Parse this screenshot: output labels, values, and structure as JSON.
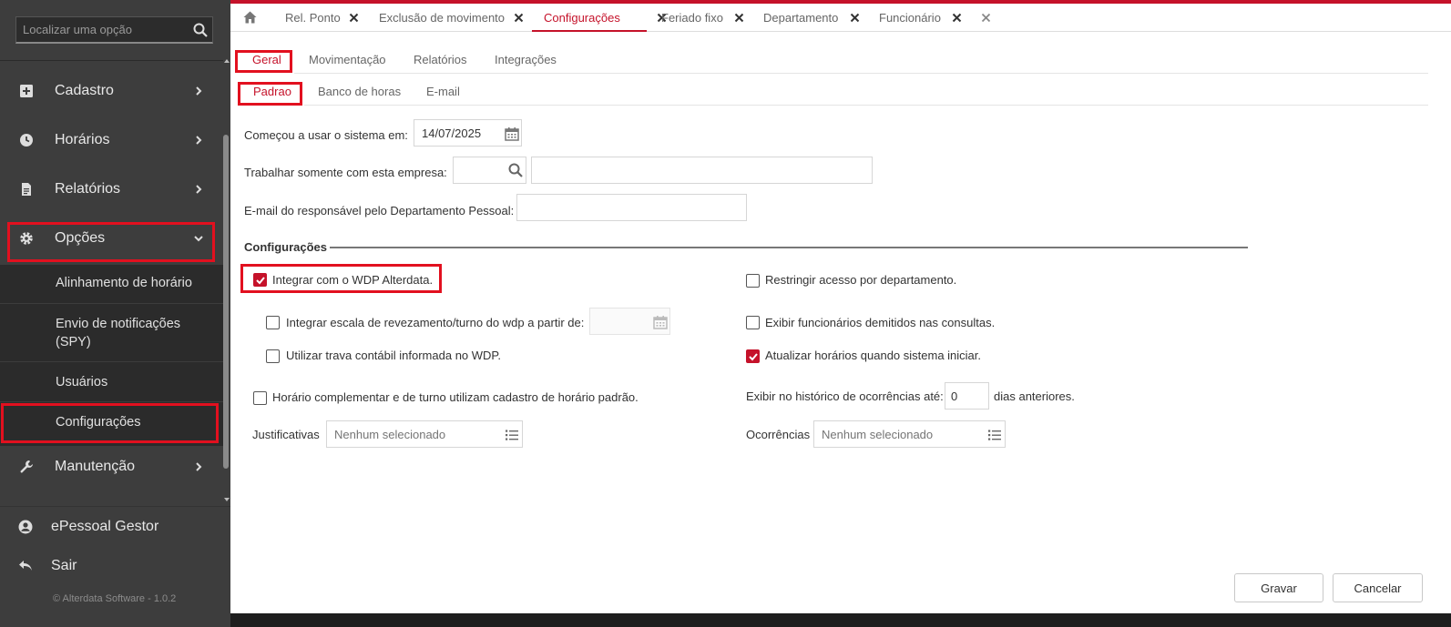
{
  "sidebar": {
    "search_placeholder": "Localizar uma opção",
    "items": [
      {
        "label": "Cadastro",
        "icon": "plus-square-icon"
      },
      {
        "label": "Horários",
        "icon": "clock-icon"
      },
      {
        "label": "Relatórios",
        "icon": "document-icon"
      },
      {
        "label": "Opções",
        "icon": "gear-icon"
      },
      {
        "label": "Manutenção",
        "icon": "wrench-icon"
      }
    ],
    "sub_items": [
      {
        "label": "Alinhamento de horário"
      },
      {
        "label": "Envio de notificações (SPY)"
      },
      {
        "label": "Usuários"
      },
      {
        "label": "Configurações"
      }
    ],
    "footer": {
      "user_label": "ePessoal Gestor",
      "logout_label": "Sair",
      "copyright": "© Alterdata Software - 1.0.2"
    }
  },
  "tabs": [
    {
      "label": "Rel. Ponto",
      "active": false
    },
    {
      "label": "Exclusão de movimento",
      "active": false
    },
    {
      "label": "Configurações",
      "active": true
    },
    {
      "label": "Feriado fixo",
      "active": false
    },
    {
      "label": "Departamento",
      "active": false
    },
    {
      "label": "Funcionário",
      "active": false
    }
  ],
  "main_tabs": [
    {
      "label": "Geral",
      "active": true
    },
    {
      "label": "Movimentação",
      "active": false
    },
    {
      "label": "Relatórios",
      "active": false
    },
    {
      "label": "Integrações",
      "active": false
    }
  ],
  "sub_tabs": [
    {
      "label": "Padrao",
      "active": true
    },
    {
      "label": "Banco de horas",
      "active": false
    },
    {
      "label": "E-mail",
      "active": false
    }
  ],
  "form": {
    "start_date_label": "Começou a usar o sistema em:",
    "start_date_value": "14/07/2025",
    "company_label": "Trabalhar somente com esta empresa:",
    "company_code_value": "",
    "company_name_value": "",
    "email_label": "E-mail do responsável pelo Departamento Pessoal:",
    "email_value": ""
  },
  "section": {
    "title": "Configurações"
  },
  "options": {
    "integrate_wdp": {
      "label": "Integrar com o WDP Alterdata.",
      "checked": true
    },
    "integrate_schedule": {
      "label": "Integrar escala de revezamento/turno do wdp a partir de:",
      "checked": false,
      "date_value": ""
    },
    "use_lock": {
      "label": "Utilizar trava contábil informada no WDP.",
      "checked": false
    },
    "complementary": {
      "label": "Horário complementar e de turno utilizam cadastro de horário padrão.",
      "checked": false
    },
    "restrict_department": {
      "label": "Restringir acesso por departamento.",
      "checked": false
    },
    "show_dismissed": {
      "label": "Exibir funcionários demitidos nas consultas.",
      "checked": false
    },
    "update_schedules": {
      "label": "Atualizar horários quando sistema iniciar.",
      "checked": true
    },
    "history_label": "Exibir no histórico de ocorrências até:",
    "history_value": "0",
    "history_suffix": "dias anteriores."
  },
  "justifications": {
    "label": "Justificativas",
    "placeholder": "Nenhum selecionado"
  },
  "occurrences": {
    "label": "Ocorrências",
    "placeholder": "Nenhum selecionado"
  },
  "buttons": {
    "save": "Gravar",
    "cancel": "Cancelar"
  },
  "colors": {
    "accent": "#c5122a",
    "sidebar_bg": "#3d3d3d",
    "highlight_box": "#e2101f"
  }
}
